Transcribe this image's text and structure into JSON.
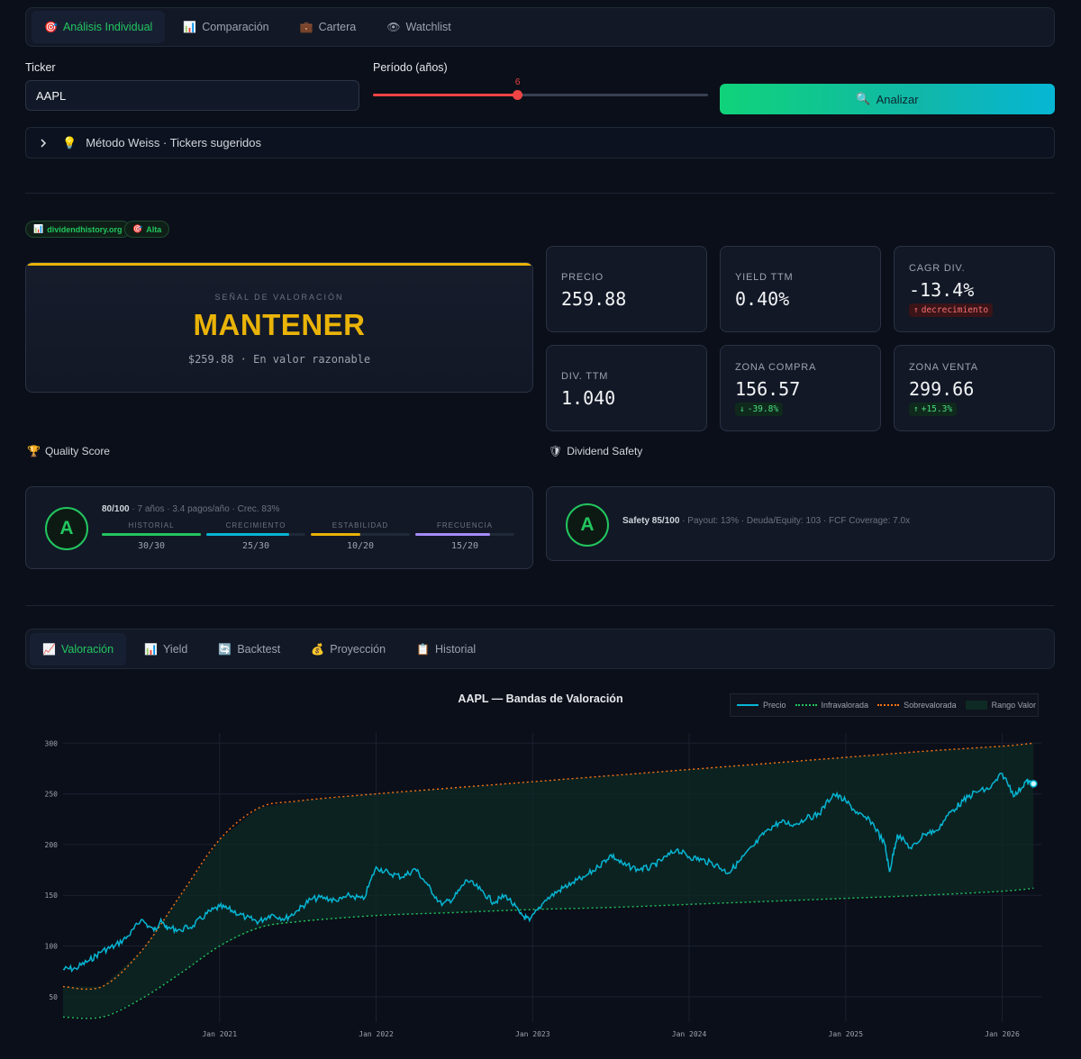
{
  "tabs": [
    {
      "icon": "🎯",
      "label": "Análisis Individual",
      "active": true
    },
    {
      "icon": "📊",
      "label": "Comparación",
      "active": false
    },
    {
      "icon": "💼",
      "label": "Cartera",
      "active": false
    },
    {
      "icon": "👁",
      "label": "Watchlist",
      "active": false
    }
  ],
  "form": {
    "ticker_label": "Ticker",
    "ticker_value": "AAPL",
    "period_label": "Período (años)",
    "period_value": "6",
    "period_fraction": 0.432,
    "analyze_icon": "🔍",
    "analyze_label": "Analizar"
  },
  "expander": {
    "icon": "💡",
    "label": "Método Weiss · Tickers sugeridos"
  },
  "pills": {
    "source": "dividendhistory.org",
    "confidence": "Alta"
  },
  "signal": {
    "sublabel": "SEÑAL DE VALORACIÓN",
    "value": "MANTENER",
    "desc": "$259.88 · En valor razonable",
    "color": "#eab308"
  },
  "metrics": {
    "precio": {
      "label": "PRECIO",
      "value": "259.88"
    },
    "yield": {
      "label": "YIELD TTM",
      "value": "0.40%"
    },
    "cagr": {
      "label": "CAGR DIV.",
      "value": "-13.4%",
      "badge": "decrecimiento"
    },
    "div": {
      "label": "DIV. TTM",
      "value": "1.040"
    },
    "compra": {
      "label": "ZONA COMPRA",
      "value": "156.57",
      "badge": "-39.8%"
    },
    "venta": {
      "label": "ZONA VENTA",
      "value": "299.66",
      "badge": "+15.3%"
    }
  },
  "quality": {
    "title": "Quality Score",
    "grade": "A",
    "score": "80/100",
    "meta": " · 7 años · 3.4 pagos/año · Crec. 83%",
    "components": [
      {
        "label": "HISTORIAL",
        "value": "30/30",
        "fraction": 1.0,
        "color": "#22c55e"
      },
      {
        "label": "CRECIMIENTO",
        "value": "25/30",
        "fraction": 0.833,
        "color": "#06b6d4"
      },
      {
        "label": "ESTABILIDAD",
        "value": "10/20",
        "fraction": 0.5,
        "color": "#eab308"
      },
      {
        "label": "FRECUENCIA",
        "value": "15/20",
        "fraction": 0.75,
        "color": "#a78bfa"
      }
    ]
  },
  "safety": {
    "title": "Dividend Safety",
    "grade": "A",
    "score": "Safety 85/100",
    "meta": " · Payout: 13% · Deuda/Equity: 103 · FCF Coverage: 7.0x"
  },
  "chart_tabs": [
    {
      "icon": "📈",
      "label": "Valoración",
      "active": true
    },
    {
      "icon": "📊",
      "label": "Yield",
      "active": false
    },
    {
      "icon": "🔄",
      "label": "Backtest",
      "active": false
    },
    {
      "icon": "💰",
      "label": "Proyección",
      "active": false
    },
    {
      "icon": "📋",
      "label": "Historial",
      "active": false
    }
  ],
  "chart_data": {
    "type": "line",
    "title": "AAPL — Bandas de Valoración",
    "legend": [
      "Precio",
      "Infravalorada",
      "Sobrevalorada",
      "Rango Valor"
    ],
    "legend_position": "top-right",
    "colors": {
      "price": "#06b6d4",
      "low": "#22c55e",
      "high": "#f97316",
      "range": "#0e2a24"
    },
    "x_ticks": [
      "Jan 2021",
      "Jan 2022",
      "Jan 2023",
      "Jan 2024",
      "Jan 2025",
      "Jan 2026"
    ],
    "y_ticks": [
      50,
      100,
      150,
      200,
      250,
      300
    ],
    "xlim": [
      2020.0,
      2026.25
    ],
    "ylim": [
      25,
      310
    ],
    "grid": true,
    "series": [
      {
        "name": "Precio",
        "x": [
          2020.0,
          2020.08,
          2020.17,
          2020.25,
          2020.33,
          2020.42,
          2020.5,
          2020.58,
          2020.62,
          2020.67,
          2020.75,
          2020.83,
          2020.92,
          2021.0,
          2021.08,
          2021.17,
          2021.25,
          2021.33,
          2021.42,
          2021.5,
          2021.58,
          2021.67,
          2021.75,
          2021.83,
          2021.92,
          2022.0,
          2022.08,
          2022.17,
          2022.25,
          2022.33,
          2022.42,
          2022.5,
          2022.58,
          2022.67,
          2022.75,
          2022.83,
          2022.92,
          2022.98,
          2023.08,
          2023.17,
          2023.25,
          2023.33,
          2023.42,
          2023.5,
          2023.58,
          2023.67,
          2023.75,
          2023.83,
          2023.92,
          2024.0,
          2024.08,
          2024.17,
          2024.25,
          2024.33,
          2024.42,
          2024.5,
          2024.58,
          2024.67,
          2024.75,
          2024.83,
          2024.92,
          2025.0,
          2025.08,
          2025.17,
          2025.25,
          2025.28,
          2025.33,
          2025.42,
          2025.5,
          2025.58,
          2025.67,
          2025.75,
          2025.83,
          2025.92,
          2026.0,
          2026.08,
          2026.15,
          2026.2
        ],
        "values": [
          77,
          78,
          86,
          95,
          100,
          110,
          126,
          115,
          124,
          118,
          116,
          120,
          132,
          139,
          135,
          128,
          124,
          131,
          127,
          135,
          146,
          148,
          144,
          150,
          146,
          178,
          172,
          168,
          176,
          160,
          140,
          148,
          165,
          155,
          143,
          150,
          132,
          125,
          145,
          155,
          162,
          168,
          178,
          190,
          180,
          176,
          177,
          185,
          195,
          188,
          185,
          180,
          172,
          185,
          200,
          215,
          222,
          220,
          226,
          230,
          250,
          243,
          230,
          222,
          200,
          173,
          210,
          196,
          210,
          214,
          232,
          243,
          252,
          255,
          270,
          248,
          262,
          260
        ]
      },
      {
        "name": "Infravalorada",
        "x": [
          2020.0,
          2020.25,
          2020.5,
          2020.75,
          2021.0,
          2021.25,
          2021.5,
          2022.0,
          2022.5,
          2023.0,
          2023.5,
          2024.0,
          2024.5,
          2025.0,
          2025.5,
          2026.0,
          2026.2
        ],
        "values": [
          30,
          30,
          48,
          73,
          100,
          118,
          124,
          130,
          133,
          136,
          138,
          141,
          144,
          147,
          150,
          154,
          157
        ]
      },
      {
        "name": "Sobrevalorada",
        "x": [
          2020.0,
          2020.25,
          2020.5,
          2020.75,
          2021.0,
          2021.25,
          2021.5,
          2022.0,
          2022.5,
          2023.0,
          2023.5,
          2024.0,
          2024.5,
          2025.0,
          2025.5,
          2026.0,
          2026.2
        ],
        "values": [
          60,
          60,
          95,
          150,
          205,
          236,
          243,
          250,
          256,
          262,
          268,
          274,
          280,
          286,
          292,
          297,
          300
        ]
      }
    ]
  }
}
